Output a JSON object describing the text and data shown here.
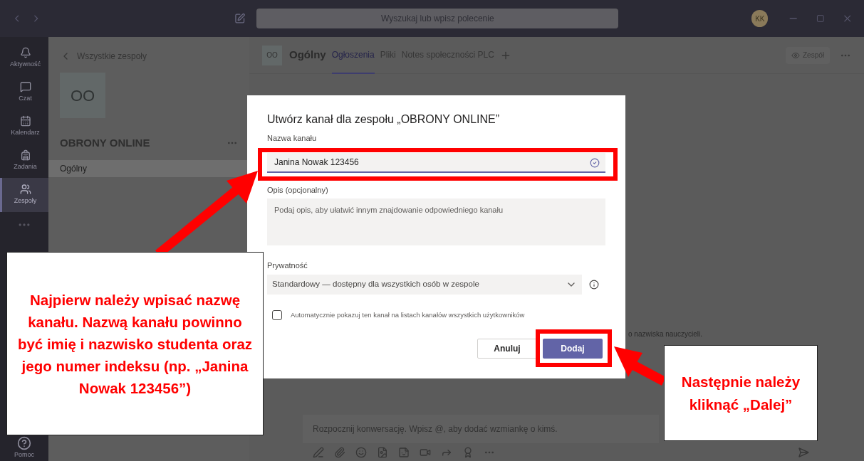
{
  "title_bar": {
    "search_placeholder": "Wyszukaj lub wpisz polecenie",
    "avatar_initials": "KK"
  },
  "rail": {
    "items": [
      {
        "label": "Aktywność",
        "selected": false
      },
      {
        "label": "Czat",
        "selected": false
      },
      {
        "label": "Kalendarz",
        "selected": false
      },
      {
        "label": "Zadania",
        "selected": false
      },
      {
        "label": "Zespoły",
        "selected": true
      }
    ],
    "help": {
      "label": "Pomoc"
    }
  },
  "team_pane": {
    "back_label": "Wszystkie zespoły",
    "tile": "OO",
    "team_name": "OBRONY ONLINE",
    "channels": [
      {
        "name": "Ogólny",
        "selected": true
      }
    ]
  },
  "channel_header": {
    "tile": "OO",
    "name": "Ogólny",
    "tabs": [
      {
        "label": "Ogłoszenia",
        "selected": true
      },
      {
        "label": "Pliki",
        "selected": false
      },
      {
        "label": "Notes społeczności PLC",
        "selected": false
      }
    ],
    "team_button": "Zespół"
  },
  "background_text": "o nazwiska nauczycieli.",
  "composer": {
    "placeholder": "Rozpocznij konwersację. Wpisz @, aby dodać wzmiankę o kimś."
  },
  "dialog": {
    "title": "Utwórz kanał dla zespołu „OBRONY ONLINE”",
    "name_label": "Nazwa kanału",
    "name_value": "Janina Nowak 123456",
    "description_label": "Opis (opcjonalny)",
    "description_placeholder": "Podaj opis, aby ułatwić innym znajdowanie odpowiedniego kanału",
    "privacy_label": "Prywatność",
    "privacy_value": "Standardowy — dostępny dla wszystkich osób w zespole",
    "auto_show": {
      "label": "Automatycznie pokazuj ten kanał na listach kanałów wszystkich użytkowników",
      "checked": false
    },
    "buttons": [
      {
        "label": "Anuluj",
        "kind": "secondary"
      },
      {
        "label": "Dodaj",
        "kind": "primary"
      }
    ]
  },
  "annotations": [
    {
      "text": "Najpierw należy wpisać nazwę kanału. Nazwą kanału powinno być imię i nazwisko studenta oraz jego numer indeksu (np. „Janina Nowak 123456”)"
    },
    {
      "text": "Następnie należy kliknąć „Dalej”"
    }
  ]
}
